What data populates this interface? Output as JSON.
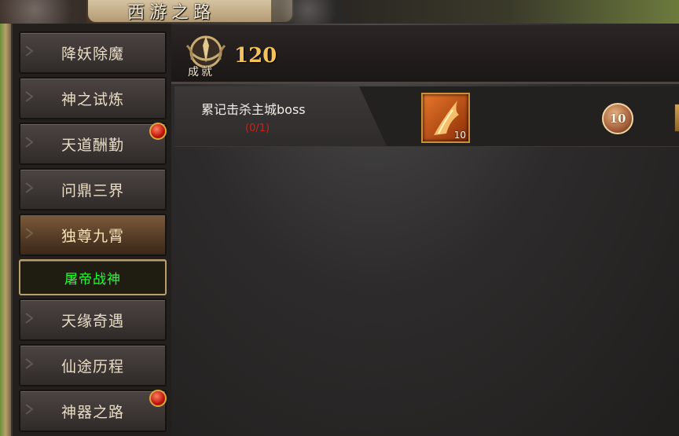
{
  "banner": {
    "title": "西游之路"
  },
  "sidebar": {
    "items": [
      {
        "label": "降妖除魔",
        "badge": false
      },
      {
        "label": "神之试炼",
        "badge": false
      },
      {
        "label": "天道酬勤",
        "badge": true
      },
      {
        "label": "问鼎三界",
        "badge": false
      },
      {
        "label": "独尊九霄",
        "badge": false
      },
      {
        "label": "屠帝战神",
        "badge": false
      },
      {
        "label": "天缘奇遇",
        "badge": false
      },
      {
        "label": "仙途历程",
        "badge": false
      },
      {
        "label": "神器之路",
        "badge": true
      }
    ]
  },
  "header": {
    "emblem_label": "成就",
    "score": "120"
  },
  "tasks": [
    {
      "name": "累记击杀主城boss",
      "progress": "(0/1)",
      "reward_item_count": "10",
      "reward_points": "10"
    }
  ],
  "colors": {
    "selected_text": "#20ff2c",
    "progress_text": "#d0201a",
    "score_text": "#f4c35a",
    "badge": "#c0140c"
  },
  "icons": {
    "emblem": "achievement-emblem-icon",
    "reward": "fire-feather-icon",
    "coin": "achievement-coin-icon"
  }
}
